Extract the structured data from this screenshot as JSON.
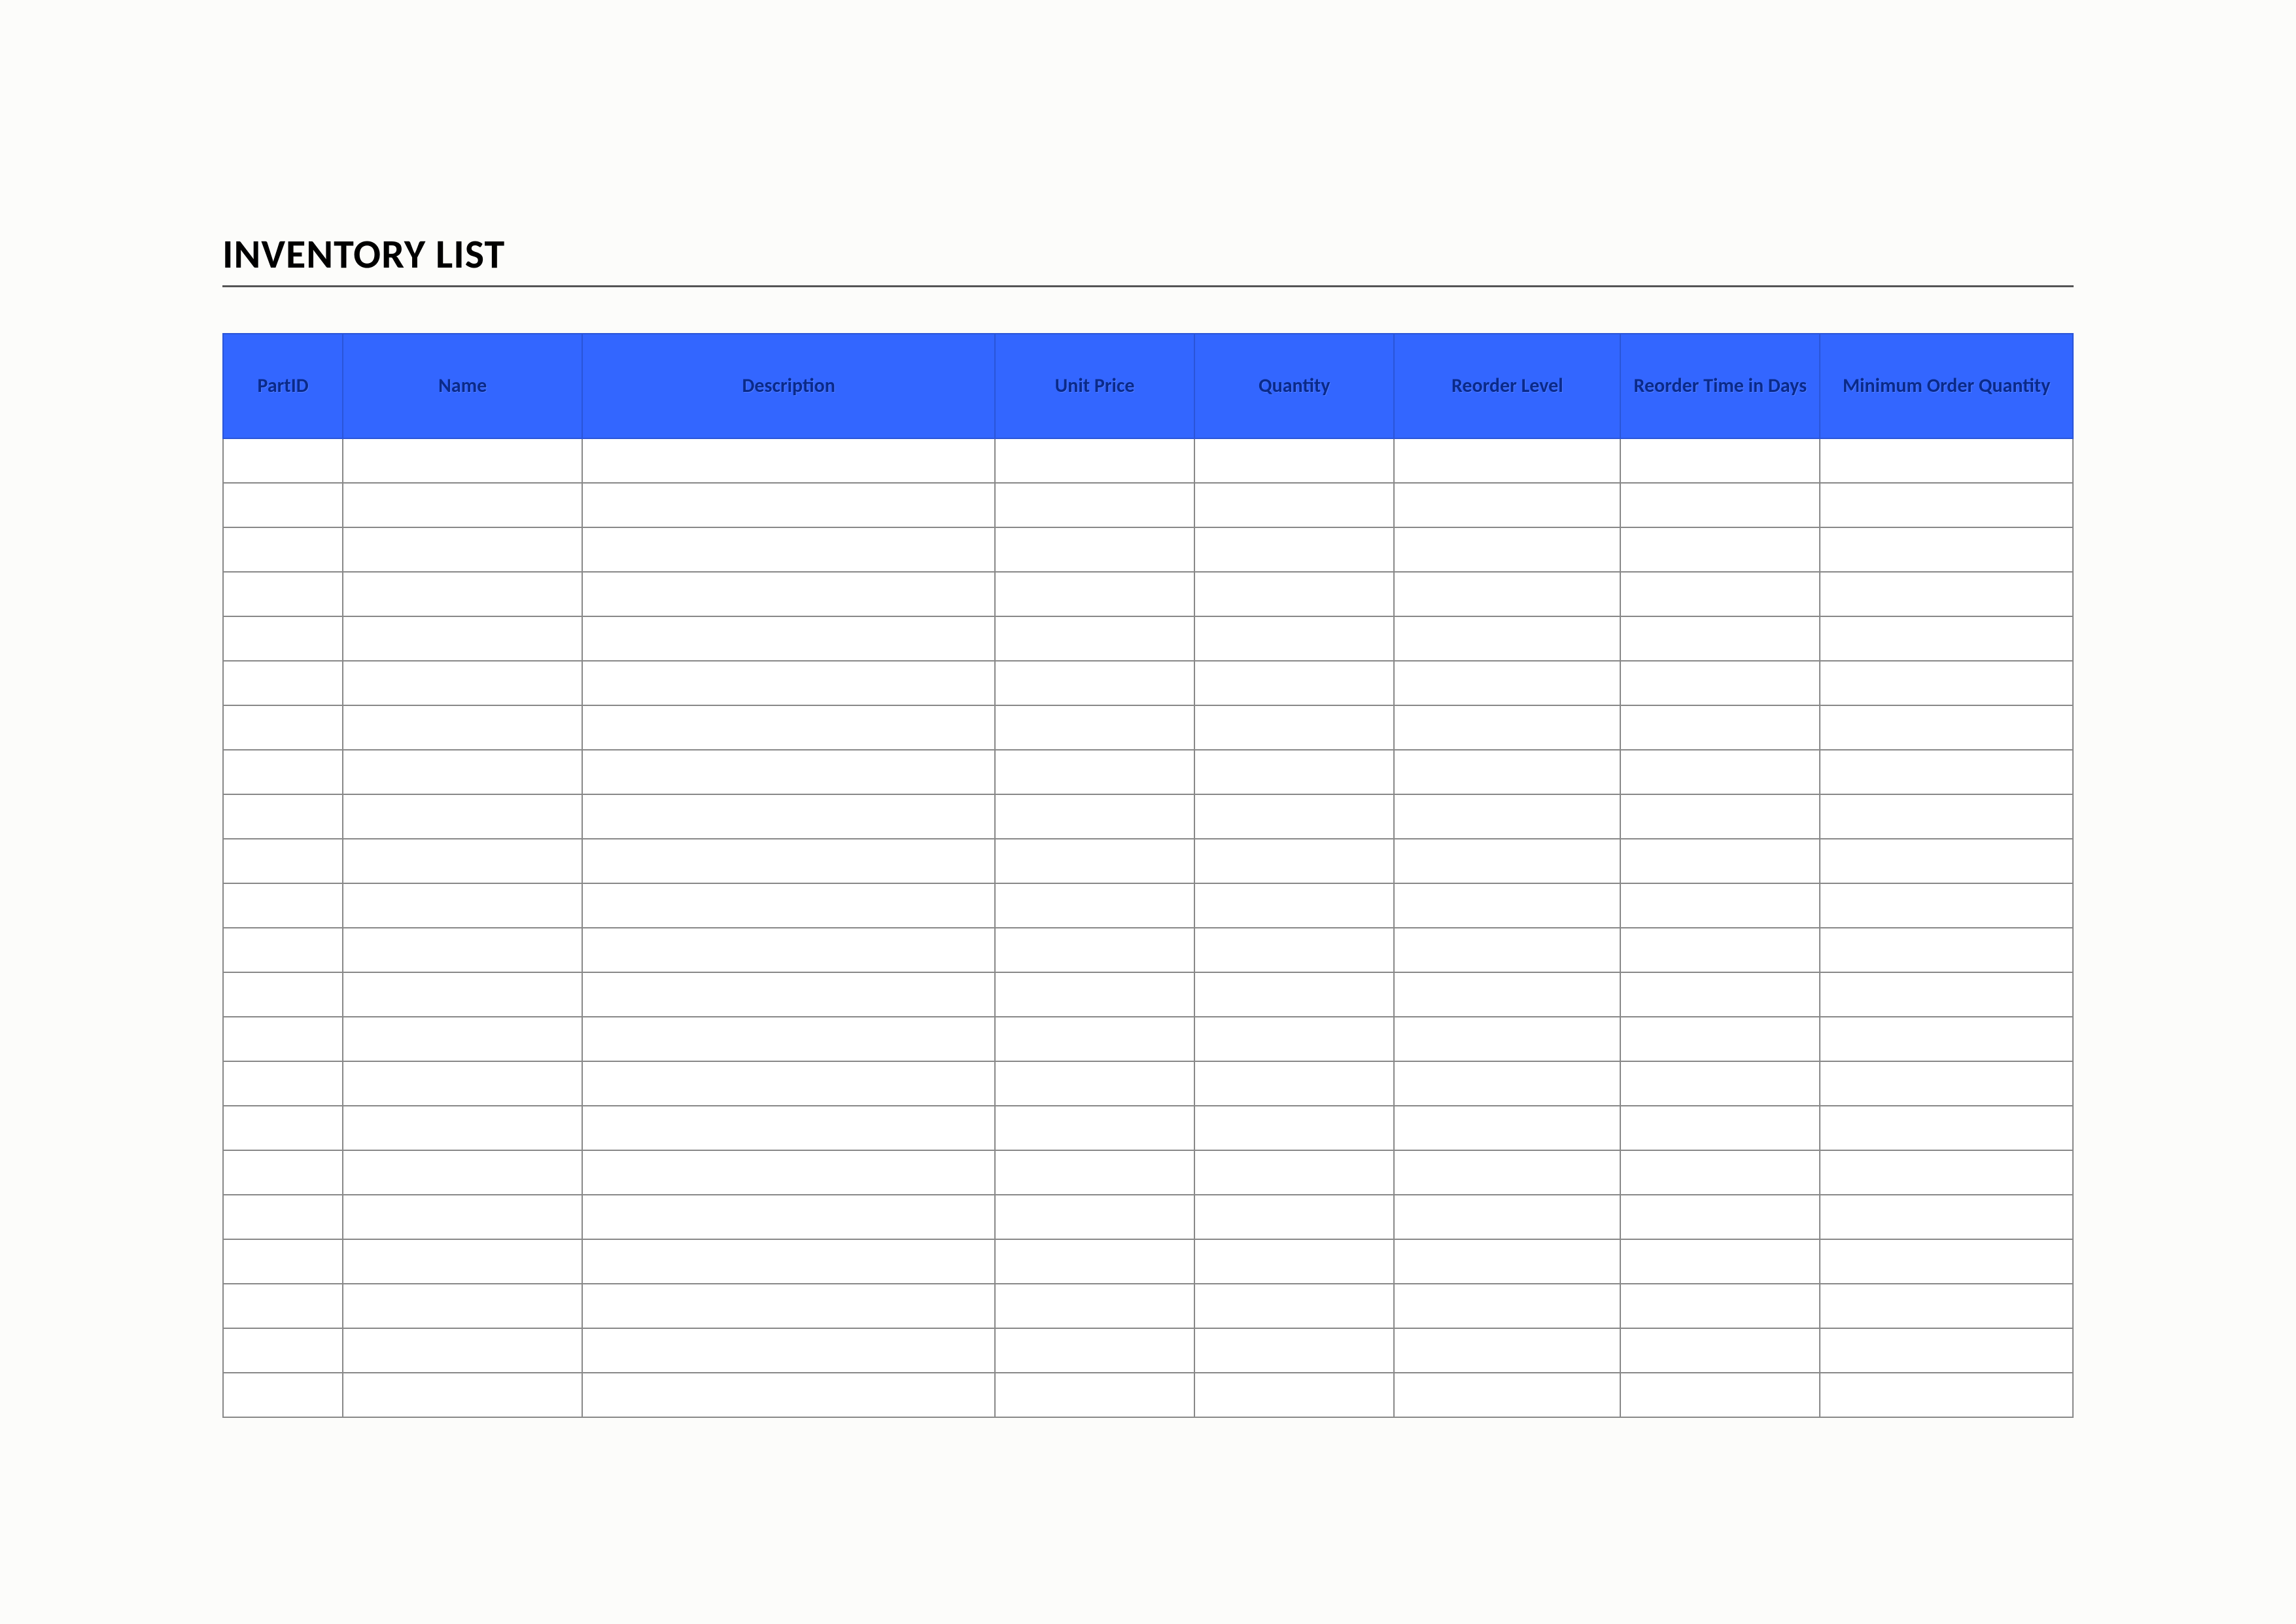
{
  "title": "INVENTORY LIST",
  "table": {
    "headers": [
      "PartID",
      "Name",
      "Description",
      "Unit Price",
      "Quantity",
      "Reorder Level",
      "Reorder Time in Days",
      "Minimum Order Quantity"
    ],
    "rows": [
      [
        "",
        "",
        "",
        "",
        "",
        "",
        "",
        ""
      ],
      [
        "",
        "",
        "",
        "",
        "",
        "",
        "",
        ""
      ],
      [
        "",
        "",
        "",
        "",
        "",
        "",
        "",
        ""
      ],
      [
        "",
        "",
        "",
        "",
        "",
        "",
        "",
        ""
      ],
      [
        "",
        "",
        "",
        "",
        "",
        "",
        "",
        ""
      ],
      [
        "",
        "",
        "",
        "",
        "",
        "",
        "",
        ""
      ],
      [
        "",
        "",
        "",
        "",
        "",
        "",
        "",
        ""
      ],
      [
        "",
        "",
        "",
        "",
        "",
        "",
        "",
        ""
      ],
      [
        "",
        "",
        "",
        "",
        "",
        "",
        "",
        ""
      ],
      [
        "",
        "",
        "",
        "",
        "",
        "",
        "",
        ""
      ],
      [
        "",
        "",
        "",
        "",
        "",
        "",
        "",
        ""
      ],
      [
        "",
        "",
        "",
        "",
        "",
        "",
        "",
        ""
      ],
      [
        "",
        "",
        "",
        "",
        "",
        "",
        "",
        ""
      ],
      [
        "",
        "",
        "",
        "",
        "",
        "",
        "",
        ""
      ],
      [
        "",
        "",
        "",
        "",
        "",
        "",
        "",
        ""
      ],
      [
        "",
        "",
        "",
        "",
        "",
        "",
        "",
        ""
      ],
      [
        "",
        "",
        "",
        "",
        "",
        "",
        "",
        ""
      ],
      [
        "",
        "",
        "",
        "",
        "",
        "",
        "",
        ""
      ],
      [
        "",
        "",
        "",
        "",
        "",
        "",
        "",
        ""
      ],
      [
        "",
        "",
        "",
        "",
        "",
        "",
        "",
        ""
      ],
      [
        "",
        "",
        "",
        "",
        "",
        "",
        "",
        ""
      ],
      [
        "",
        "",
        "",
        "",
        "",
        "",
        "",
        ""
      ]
    ]
  }
}
